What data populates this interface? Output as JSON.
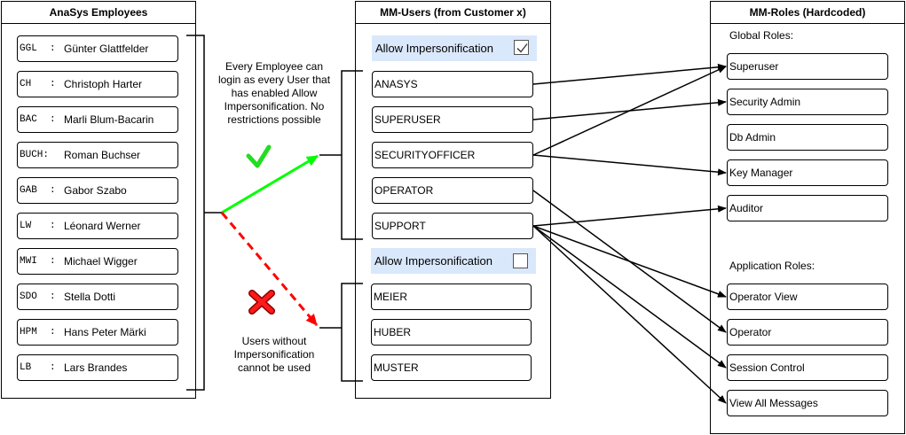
{
  "panels": {
    "employees": {
      "title": "AnaSys Employees"
    },
    "users": {
      "title": "MM-Users (from Customer x)"
    },
    "roles": {
      "title": "MM-Roles (Hardcoded)"
    }
  },
  "employees": [
    {
      "code": "GGL",
      "name": "Günter Glattfelder"
    },
    {
      "code": "CH",
      "name": "Christoph Harter"
    },
    {
      "code": "BAC",
      "name": "Marli Blum-Bacarin"
    },
    {
      "code": "BUCH:",
      "name": "Roman Buchser"
    },
    {
      "code": "GAB",
      "name": "Gabor Szabo"
    },
    {
      "code": "LW",
      "name": "Léonard Werner"
    },
    {
      "code": "MWI",
      "name": "Michael Wigger"
    },
    {
      "code": "SDO",
      "name": "Stella Dotti"
    },
    {
      "code": "HPM",
      "name": "Hans Peter Märki"
    },
    {
      "code": "LB",
      "name": "Lars Brandes"
    }
  ],
  "users_group1": {
    "impersonification_label": "Allow Impersonification",
    "impersonification_checked": true,
    "users": [
      "ANASYS",
      "SUPERUSER",
      "SECURITYOFFICER",
      "OPERATOR",
      "SUPPORT"
    ]
  },
  "users_group2": {
    "impersonification_label": "Allow Impersonification",
    "impersonification_checked": false,
    "users": [
      "MEIER",
      "HUBER",
      "MUSTER"
    ]
  },
  "roles": {
    "global_label": "Global Roles:",
    "global": [
      "Superuser",
      "Security Admin",
      "Db Admin",
      "Key Manager",
      "Auditor"
    ],
    "application_label": "Application Roles:",
    "application": [
      "Operator View",
      "Operator",
      "Session Control",
      "View All Messages"
    ]
  },
  "notes": {
    "allowed": "Every Employee can login as every User that has enabled Allow Impersonification. No restrictions possible",
    "denied": "Users without Impersonification cannot be used"
  },
  "colors": {
    "allowed": "#00ff00",
    "denied": "#ff0000",
    "highlight": "#dae8fc"
  },
  "mappings": [
    {
      "user": "ANASYS",
      "role": "Superuser"
    },
    {
      "user": "SUPERUSER",
      "role": "Security Admin"
    },
    {
      "user": "SECURITYOFFICER",
      "role": "Superuser"
    },
    {
      "user": "SECURITYOFFICER",
      "role": "Key Manager"
    },
    {
      "user": "OPERATOR",
      "role": "Operator"
    },
    {
      "user": "SUPPORT",
      "role": "Auditor"
    },
    {
      "user": "SUPPORT",
      "role": "Operator View"
    },
    {
      "user": "SUPPORT",
      "role": "Session Control"
    },
    {
      "user": "SUPPORT",
      "role": "View All Messages"
    }
  ]
}
